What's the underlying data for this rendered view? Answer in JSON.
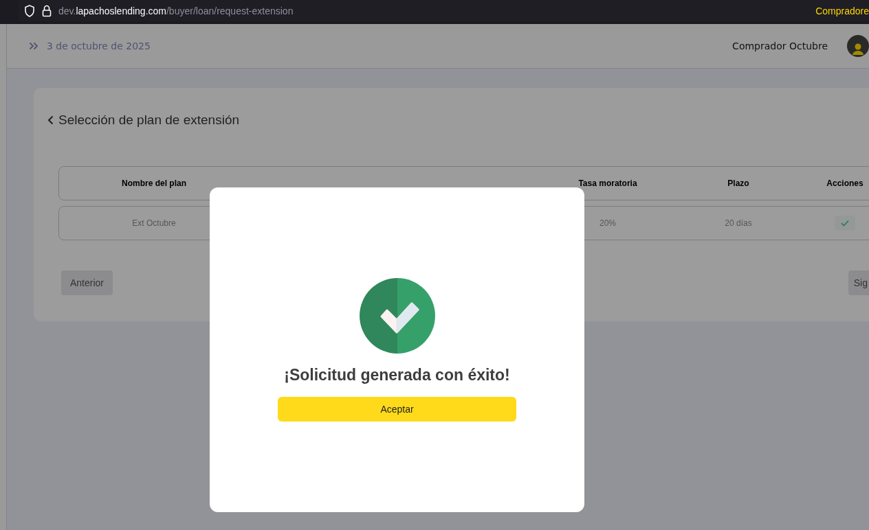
{
  "browser": {
    "url_subdomain": "dev.",
    "url_domain": "lapachoslending.com",
    "url_path": "/buyer/loan/request-extension",
    "profile_label": "Compradore"
  },
  "header": {
    "date": "3 de octubre de 2025",
    "user_name": "Comprador Octubre"
  },
  "card": {
    "title": "Selección de plan de extensión",
    "table": {
      "columns": [
        "Nombre del plan",
        "Tasa moratoria",
        "Plazo",
        "Acciones"
      ],
      "rows": [
        {
          "cells": [
            "Ext Octubre",
            "20%",
            "20 días"
          ]
        }
      ]
    },
    "buttons": [
      "Anterior",
      "Sig"
    ]
  },
  "modal": {
    "title": "¡Solicitud generada con éxito!",
    "button": "Aceptar"
  }
}
